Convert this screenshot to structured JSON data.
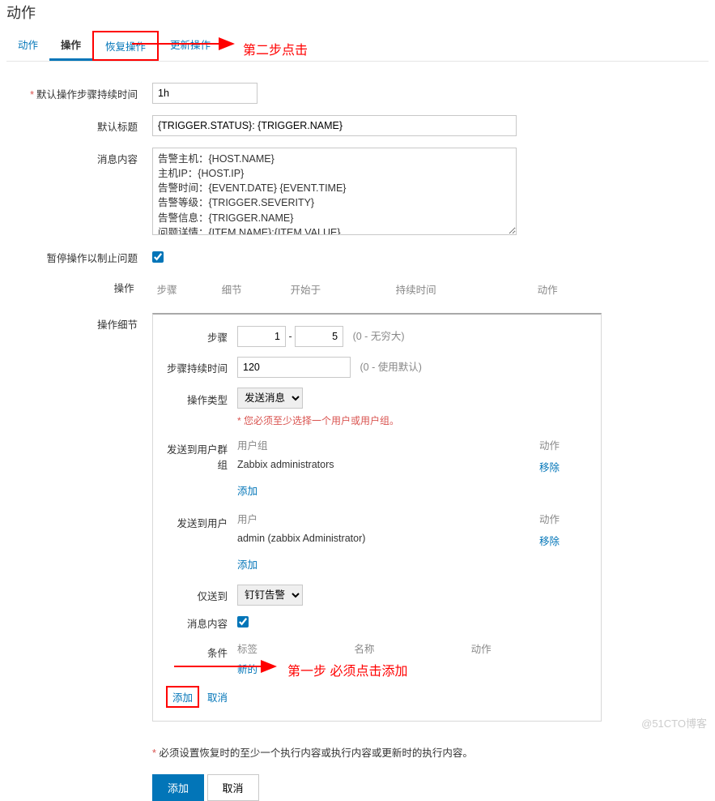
{
  "page_title": "动作",
  "tabs": {
    "action": "动作",
    "ops": "操作",
    "recovery": "恢复操作",
    "update": "更新操作"
  },
  "labels": {
    "default_duration": "默认操作步骤持续时间",
    "default_subject": "默认标题",
    "msg_content": "消息内容",
    "pause": "暂停操作以制止问题",
    "operations": "操作",
    "op_detail": "操作细节",
    "steps": "步骤",
    "step_duration": "步骤持续时间",
    "op_type": "操作类型",
    "send_group": "发送到用户群组",
    "send_user": "发送到用户",
    "only_to": "仅送到",
    "detail_msg": "消息内容",
    "conditions": "条件"
  },
  "values": {
    "duration": "1h",
    "subject": "{TRIGGER.STATUS}: {TRIGGER.NAME}",
    "msg": "告警主机：{HOST.NAME}\n主机IP：{HOST.IP}\n告警时间：{EVENT.DATE} {EVENT.TIME}\n告警等级：{TRIGGER.SEVERITY}\n告警信息：{TRIGGER.NAME}\n问题详情：{ITEM.NAME}:{ITEM.VALUE}",
    "step_from": "1",
    "step_to": "5",
    "step_hint": "(0 - 无穷大)",
    "step_dur": "120",
    "step_dur_hint": "(0 - 使用默认)",
    "op_type_val": "发送消息",
    "op_type_note": "您必须至少选择一个用户或用户组。",
    "user_group": "用户组",
    "group_val": "Zabbix administrators",
    "user": "用户",
    "user_val": "admin (zabbix Administrator)",
    "action_col": "动作",
    "remove": "移除",
    "add": "添加",
    "only_to_val": "钉钉告警",
    "cond_tag": "标签",
    "cond_name": "名称",
    "cond_action": "动作",
    "new_cond": "新的",
    "cancel": "取消",
    "final_note": "必须设置恢复时的至少一个执行内容或执行内容或更新时的执行内容。",
    "btn_add": "添加",
    "btn_cancel": "取消"
  },
  "ops_cols": {
    "step": "步骤",
    "detail": "细节",
    "start": "开始于",
    "dur": "持续时间",
    "act": "动作"
  },
  "annotations": {
    "step1": "第一步 必须点击添加",
    "step2": "第二步点击"
  },
  "watermark": "@51CTO博客"
}
